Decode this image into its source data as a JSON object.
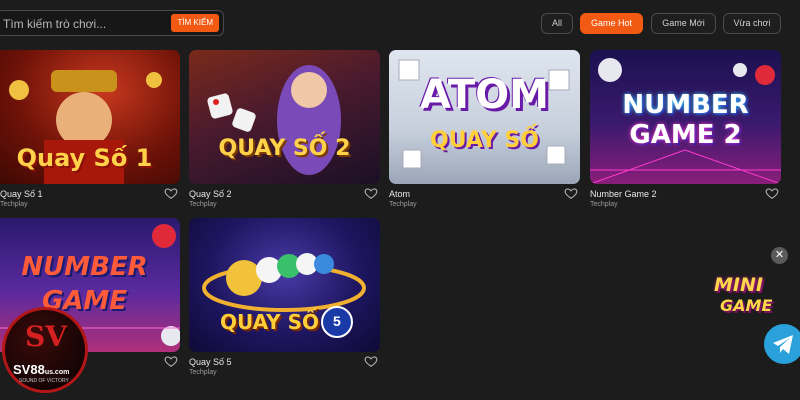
{
  "search": {
    "placeholder": "Tìm kiếm trò chơi...",
    "button_label": "TÌM KIẾM"
  },
  "filters": [
    {
      "label": "All",
      "active": false
    },
    {
      "label": "Game Hot",
      "active": true
    },
    {
      "label": "Game Mới",
      "active": false
    },
    {
      "label": "Vừa chơi",
      "active": false
    }
  ],
  "games": [
    {
      "title": "Quay Số 1",
      "provider": "Techplay",
      "art_text": "Quay Số 1"
    },
    {
      "title": "Quay Số 2",
      "provider": "Techplay",
      "art_text": "QUAY SỐ 2"
    },
    {
      "title": "Atom",
      "provider": "Techplay",
      "art_text": "ATOM",
      "art_sub": "QUAY SỐ"
    },
    {
      "title": "Number Game 2",
      "provider": "Techplay",
      "art_text": "NUMBER",
      "art_sub": "GAME 2"
    },
    {
      "title": "",
      "provider": "",
      "art_text": "NUMBER",
      "art_sub": "GAME"
    },
    {
      "title": "Quay Số 5",
      "provider": "Techplay",
      "art_text": "QUAY SỐ",
      "art_sub": "5"
    }
  ],
  "brand": {
    "name": "SV88",
    "domain": "us.com",
    "slogan": "SOUND OF VICTORY"
  },
  "widgets": {
    "mini_game_label_1": "MINI",
    "mini_game_label_2": "GAME",
    "close_icon": "close-icon",
    "telegram_icon": "telegram-icon"
  },
  "colors": {
    "accent": "#f25a14",
    "background": "#1c1c1c",
    "telegram": "#2aa1da"
  }
}
